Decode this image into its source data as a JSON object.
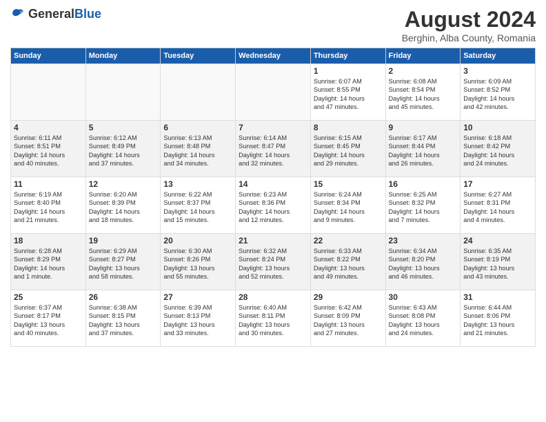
{
  "header": {
    "logo_general": "General",
    "logo_blue": "Blue",
    "month_title": "August 2024",
    "location": "Berghin, Alba County, Romania"
  },
  "days_of_week": [
    "Sunday",
    "Monday",
    "Tuesday",
    "Wednesday",
    "Thursday",
    "Friday",
    "Saturday"
  ],
  "weeks": [
    [
      {
        "num": "",
        "info": "",
        "empty": true
      },
      {
        "num": "",
        "info": "",
        "empty": true
      },
      {
        "num": "",
        "info": "",
        "empty": true
      },
      {
        "num": "",
        "info": "",
        "empty": true
      },
      {
        "num": "1",
        "info": "Sunrise: 6:07 AM\nSunset: 8:55 PM\nDaylight: 14 hours\nand 47 minutes.",
        "empty": false
      },
      {
        "num": "2",
        "info": "Sunrise: 6:08 AM\nSunset: 8:54 PM\nDaylight: 14 hours\nand 45 minutes.",
        "empty": false
      },
      {
        "num": "3",
        "info": "Sunrise: 6:09 AM\nSunset: 8:52 PM\nDaylight: 14 hours\nand 42 minutes.",
        "empty": false
      }
    ],
    [
      {
        "num": "4",
        "info": "Sunrise: 6:11 AM\nSunset: 8:51 PM\nDaylight: 14 hours\nand 40 minutes.",
        "empty": false
      },
      {
        "num": "5",
        "info": "Sunrise: 6:12 AM\nSunset: 8:49 PM\nDaylight: 14 hours\nand 37 minutes.",
        "empty": false
      },
      {
        "num": "6",
        "info": "Sunrise: 6:13 AM\nSunset: 8:48 PM\nDaylight: 14 hours\nand 34 minutes.",
        "empty": false
      },
      {
        "num": "7",
        "info": "Sunrise: 6:14 AM\nSunset: 8:47 PM\nDaylight: 14 hours\nand 32 minutes.",
        "empty": false
      },
      {
        "num": "8",
        "info": "Sunrise: 6:15 AM\nSunset: 8:45 PM\nDaylight: 14 hours\nand 29 minutes.",
        "empty": false
      },
      {
        "num": "9",
        "info": "Sunrise: 6:17 AM\nSunset: 8:44 PM\nDaylight: 14 hours\nand 26 minutes.",
        "empty": false
      },
      {
        "num": "10",
        "info": "Sunrise: 6:18 AM\nSunset: 8:42 PM\nDaylight: 14 hours\nand 24 minutes.",
        "empty": false
      }
    ],
    [
      {
        "num": "11",
        "info": "Sunrise: 6:19 AM\nSunset: 8:40 PM\nDaylight: 14 hours\nand 21 minutes.",
        "empty": false
      },
      {
        "num": "12",
        "info": "Sunrise: 6:20 AM\nSunset: 8:39 PM\nDaylight: 14 hours\nand 18 minutes.",
        "empty": false
      },
      {
        "num": "13",
        "info": "Sunrise: 6:22 AM\nSunset: 8:37 PM\nDaylight: 14 hours\nand 15 minutes.",
        "empty": false
      },
      {
        "num": "14",
        "info": "Sunrise: 6:23 AM\nSunset: 8:36 PM\nDaylight: 14 hours\nand 12 minutes.",
        "empty": false
      },
      {
        "num": "15",
        "info": "Sunrise: 6:24 AM\nSunset: 8:34 PM\nDaylight: 14 hours\nand 9 minutes.",
        "empty": false
      },
      {
        "num": "16",
        "info": "Sunrise: 6:25 AM\nSunset: 8:32 PM\nDaylight: 14 hours\nand 7 minutes.",
        "empty": false
      },
      {
        "num": "17",
        "info": "Sunrise: 6:27 AM\nSunset: 8:31 PM\nDaylight: 14 hours\nand 4 minutes.",
        "empty": false
      }
    ],
    [
      {
        "num": "18",
        "info": "Sunrise: 6:28 AM\nSunset: 8:29 PM\nDaylight: 14 hours\nand 1 minute.",
        "empty": false
      },
      {
        "num": "19",
        "info": "Sunrise: 6:29 AM\nSunset: 8:27 PM\nDaylight: 13 hours\nand 58 minutes.",
        "empty": false
      },
      {
        "num": "20",
        "info": "Sunrise: 6:30 AM\nSunset: 8:26 PM\nDaylight: 13 hours\nand 55 minutes.",
        "empty": false
      },
      {
        "num": "21",
        "info": "Sunrise: 6:32 AM\nSunset: 8:24 PM\nDaylight: 13 hours\nand 52 minutes.",
        "empty": false
      },
      {
        "num": "22",
        "info": "Sunrise: 6:33 AM\nSunset: 8:22 PM\nDaylight: 13 hours\nand 49 minutes.",
        "empty": false
      },
      {
        "num": "23",
        "info": "Sunrise: 6:34 AM\nSunset: 8:20 PM\nDaylight: 13 hours\nand 46 minutes.",
        "empty": false
      },
      {
        "num": "24",
        "info": "Sunrise: 6:35 AM\nSunset: 8:19 PM\nDaylight: 13 hours\nand 43 minutes.",
        "empty": false
      }
    ],
    [
      {
        "num": "25",
        "info": "Sunrise: 6:37 AM\nSunset: 8:17 PM\nDaylight: 13 hours\nand 40 minutes.",
        "empty": false
      },
      {
        "num": "26",
        "info": "Sunrise: 6:38 AM\nSunset: 8:15 PM\nDaylight: 13 hours\nand 37 minutes.",
        "empty": false
      },
      {
        "num": "27",
        "info": "Sunrise: 6:39 AM\nSunset: 8:13 PM\nDaylight: 13 hours\nand 33 minutes.",
        "empty": false
      },
      {
        "num": "28",
        "info": "Sunrise: 6:40 AM\nSunset: 8:11 PM\nDaylight: 13 hours\nand 30 minutes.",
        "empty": false
      },
      {
        "num": "29",
        "info": "Sunrise: 6:42 AM\nSunset: 8:09 PM\nDaylight: 13 hours\nand 27 minutes.",
        "empty": false
      },
      {
        "num": "30",
        "info": "Sunrise: 6:43 AM\nSunset: 8:08 PM\nDaylight: 13 hours\nand 24 minutes.",
        "empty": false
      },
      {
        "num": "31",
        "info": "Sunrise: 6:44 AM\nSunset: 8:06 PM\nDaylight: 13 hours\nand 21 minutes.",
        "empty": false
      }
    ]
  ]
}
